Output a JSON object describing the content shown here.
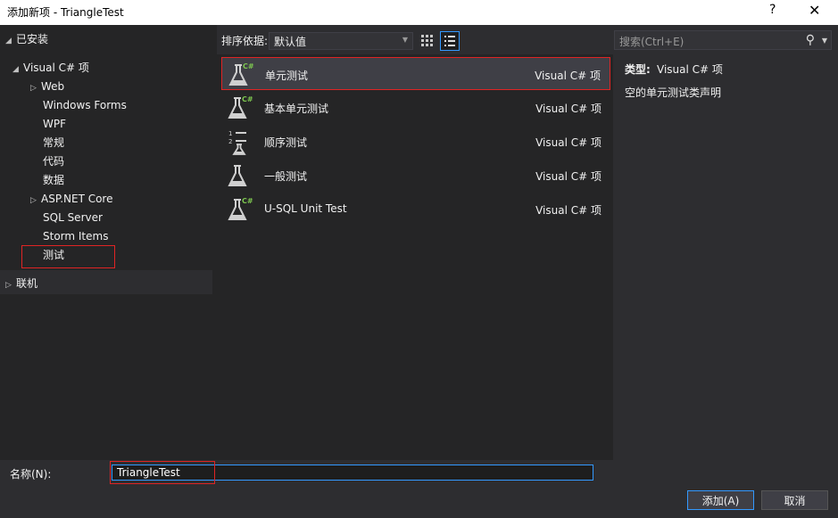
{
  "window": {
    "title": "添加新项 - TriangleTest",
    "help": "?",
    "close": "✕"
  },
  "tree": {
    "installed": "已安装",
    "visual_cs": "Visual C# 项",
    "items": [
      "Web",
      "Windows Forms",
      "WPF",
      "常规",
      "代码",
      "数据",
      "ASP.NET Core",
      "SQL Server",
      "Storm Items",
      "测试"
    ],
    "online": "联机"
  },
  "toolbar": {
    "sort_label": "排序依据:",
    "sort_value": "默认值"
  },
  "templates": [
    {
      "name": "单元测试",
      "lang": "Visual C# 项",
      "icon": "unit-test-flask-icon",
      "selected": true
    },
    {
      "name": "基本单元测试",
      "lang": "Visual C# 项",
      "icon": "basic-test-flask-icon",
      "selected": false
    },
    {
      "name": "顺序测试",
      "lang": "Visual C# 项",
      "icon": "ordered-test-icon",
      "selected": false
    },
    {
      "name": "一般测试",
      "lang": "Visual C# 项",
      "icon": "generic-test-flask-icon",
      "selected": false
    },
    {
      "name": "U-SQL Unit Test",
      "lang": "Visual C# 项",
      "icon": "usql-test-flask-icon",
      "selected": false
    }
  ],
  "search": {
    "placeholder": "搜索(Ctrl+E)"
  },
  "details": {
    "type_label": "类型:",
    "type_value": "Visual C# 项",
    "description": "空的单元测试类声明"
  },
  "bottom": {
    "name_label": "名称(N):",
    "name_value": "TriangleTest",
    "add_button": "添加(A)",
    "cancel_button": "取消"
  },
  "colors": {
    "accent": "#3399ff",
    "highlight": "#e02424",
    "background": "#2d2d30"
  }
}
